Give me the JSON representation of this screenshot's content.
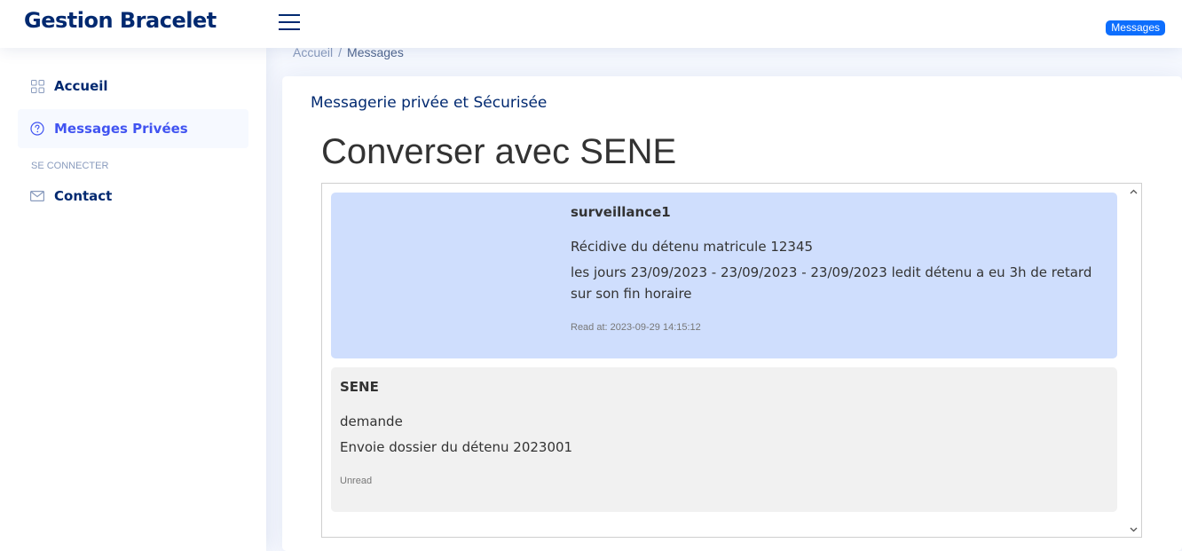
{
  "header": {
    "logo": "Gestion Bracelet",
    "messages_badge": "Messages"
  },
  "sidebar": {
    "items": [
      {
        "label": "Accueil",
        "icon": "grid-icon"
      },
      {
        "label": "Messages Privées",
        "icon": "question-circle-icon",
        "active": true
      }
    ],
    "heading": "SE CONNECTER",
    "contact": {
      "label": "Contact",
      "icon": "envelope-icon"
    }
  },
  "breadcrumb": {
    "home": "Accueil",
    "separator": "/",
    "current": "Messages"
  },
  "card": {
    "title": "Messagerie privée et Sécurisée",
    "conversation_title": "Converser avec SENE"
  },
  "messages": [
    {
      "author": "surveillance1",
      "lines": [
        "Récidive du détenu matricule 12345",
        "les jours 23/09/2023 - 23/09/2023 - 23/09/2023 ledit détenu a eu 3h de retard sur son fin horaire"
      ],
      "status": "Read at: 2023-09-29 14:15:12"
    },
    {
      "author": "SENE",
      "lines": [
        "demande",
        "Envoie dossier du détenu 2023001"
      ],
      "status": "Unread"
    }
  ],
  "colors": {
    "brand": "#012970",
    "accent": "#4154f1",
    "badge": "#0d6efd",
    "outgoing_bubble": "#cfdefd",
    "incoming_bubble": "#f1f1f1"
  }
}
